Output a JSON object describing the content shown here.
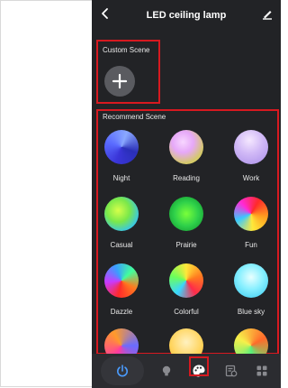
{
  "header": {
    "title": "LED ceiling lamp",
    "back_icon": "chevron-left-icon",
    "edit_icon": "pencil-icon"
  },
  "custom_scene": {
    "label": "Custom Scene",
    "add_icon": "plus-icon"
  },
  "recommend_scene": {
    "label": "Recommend Scene",
    "scenes": [
      {
        "name": "Night"
      },
      {
        "name": "Reading"
      },
      {
        "name": "Work"
      },
      {
        "name": "Casual"
      },
      {
        "name": "Prairie"
      },
      {
        "name": "Fun"
      },
      {
        "name": "Dazzle"
      },
      {
        "name": "Colorful"
      },
      {
        "name": "Blue sky"
      },
      {
        "name": ""
      },
      {
        "name": ""
      },
      {
        "name": ""
      }
    ]
  },
  "bottom_nav": {
    "items": [
      {
        "icon": "power-icon",
        "active": false
      },
      {
        "icon": "bulb-icon",
        "active": false
      },
      {
        "icon": "palette-icon",
        "active": true
      },
      {
        "icon": "schedule-icon",
        "active": false
      },
      {
        "icon": "grid-icon",
        "active": false
      }
    ]
  },
  "colors": {
    "background": "#222326",
    "highlight": "#d71920",
    "power_accent": "#4a9cff"
  }
}
